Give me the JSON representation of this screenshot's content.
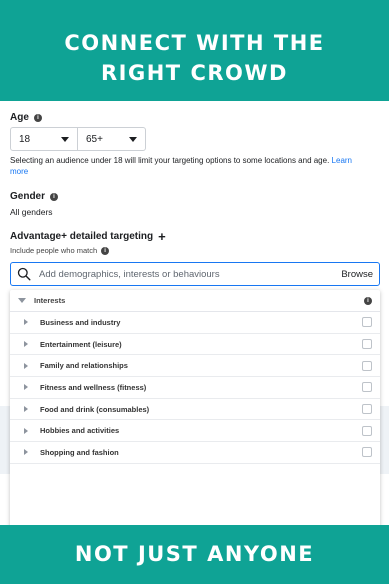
{
  "banner": {
    "top_line1": "CONNECT WITH THE",
    "top_line2": "RIGHT CROWD",
    "bottom": "NOT JUST ANYONE"
  },
  "age": {
    "label": "Age",
    "min": "18",
    "max": "65+",
    "note": "Selecting an audience under 18 will limit your targeting options to some locations and age.",
    "learn_more": "Learn more"
  },
  "gender": {
    "label": "Gender",
    "value": "All genders"
  },
  "targeting": {
    "label": "Advantage+ detailed targeting",
    "plus": "+",
    "include_label": "Include people who match",
    "search_placeholder": "Add demographics, interests or behaviours",
    "browse": "Browse"
  },
  "dropdown": {
    "header": "Interests",
    "items": [
      {
        "label": "Business and industry"
      },
      {
        "label": "Entertainment (leisure)"
      },
      {
        "label": "Family and relationships"
      },
      {
        "label": "Fitness and wellness (fitness)"
      },
      {
        "label": "Food and drink (consumables)"
      },
      {
        "label": "Hobbies and activities"
      },
      {
        "label": "Shopping and fashion"
      }
    ]
  },
  "colors": {
    "brand_teal": "#0fa395",
    "link_blue": "#1877f2"
  }
}
